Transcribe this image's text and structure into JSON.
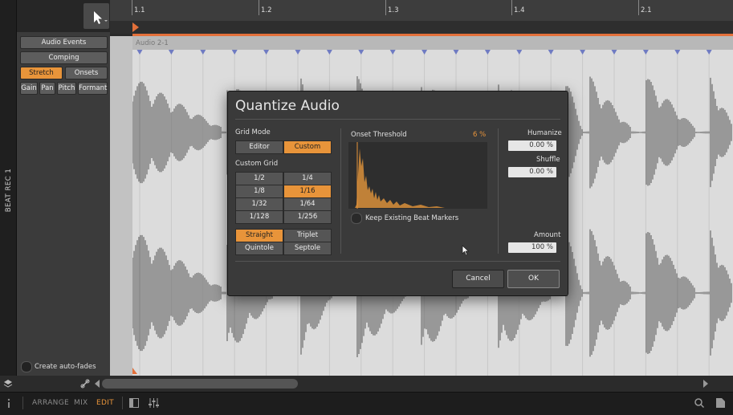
{
  "track": {
    "name": "BEAT REC 1"
  },
  "inspector": {
    "buttons": [
      "Audio Events",
      "Comping"
    ],
    "modes": [
      "Stretch",
      "Onsets"
    ],
    "params": [
      "Gain",
      "Pan",
      "Pitch",
      "Formant"
    ],
    "auto_fades_label": "Create auto-fades"
  },
  "ruler": {
    "ticks": [
      "1.1",
      "1.2",
      "1.3",
      "1.4",
      "2.1"
    ]
  },
  "clip": {
    "name": "Audio 2-1"
  },
  "bottombar": {
    "tabs": [
      "ARRANGE",
      "MIX",
      "EDIT"
    ],
    "active": "EDIT"
  },
  "dialog": {
    "title": "Quantize Audio",
    "grid_mode_label": "Grid Mode",
    "grid_modes": [
      "Editor",
      "Custom"
    ],
    "custom_grid_label": "Custom Grid",
    "grid_values": [
      "1/2",
      "1/4",
      "1/8",
      "1/16",
      "1/32",
      "1/64",
      "1/128",
      "1/256"
    ],
    "grid_selected": "1/16",
    "feel_options": [
      "Straight",
      "Triplet",
      "Quintole",
      "Septole"
    ],
    "feel_selected": "Straight",
    "onset_threshold_label": "Onset Threshold",
    "onset_threshold_value": "6 %",
    "keep_markers_label": "Keep Existing Beat Markers",
    "humanize_label": "Humanize",
    "humanize_value": "0.00 %",
    "shuffle_label": "Shuffle",
    "shuffle_value": "0.00 %",
    "amount_label": "Amount",
    "amount_value": "100 %",
    "cancel_label": "Cancel",
    "ok_label": "OK"
  },
  "colors": {
    "accent": "#e8943a",
    "marker": "#6f7bc2",
    "clip_bg": "#dcdcdc",
    "loop_line": "#e3703a"
  }
}
